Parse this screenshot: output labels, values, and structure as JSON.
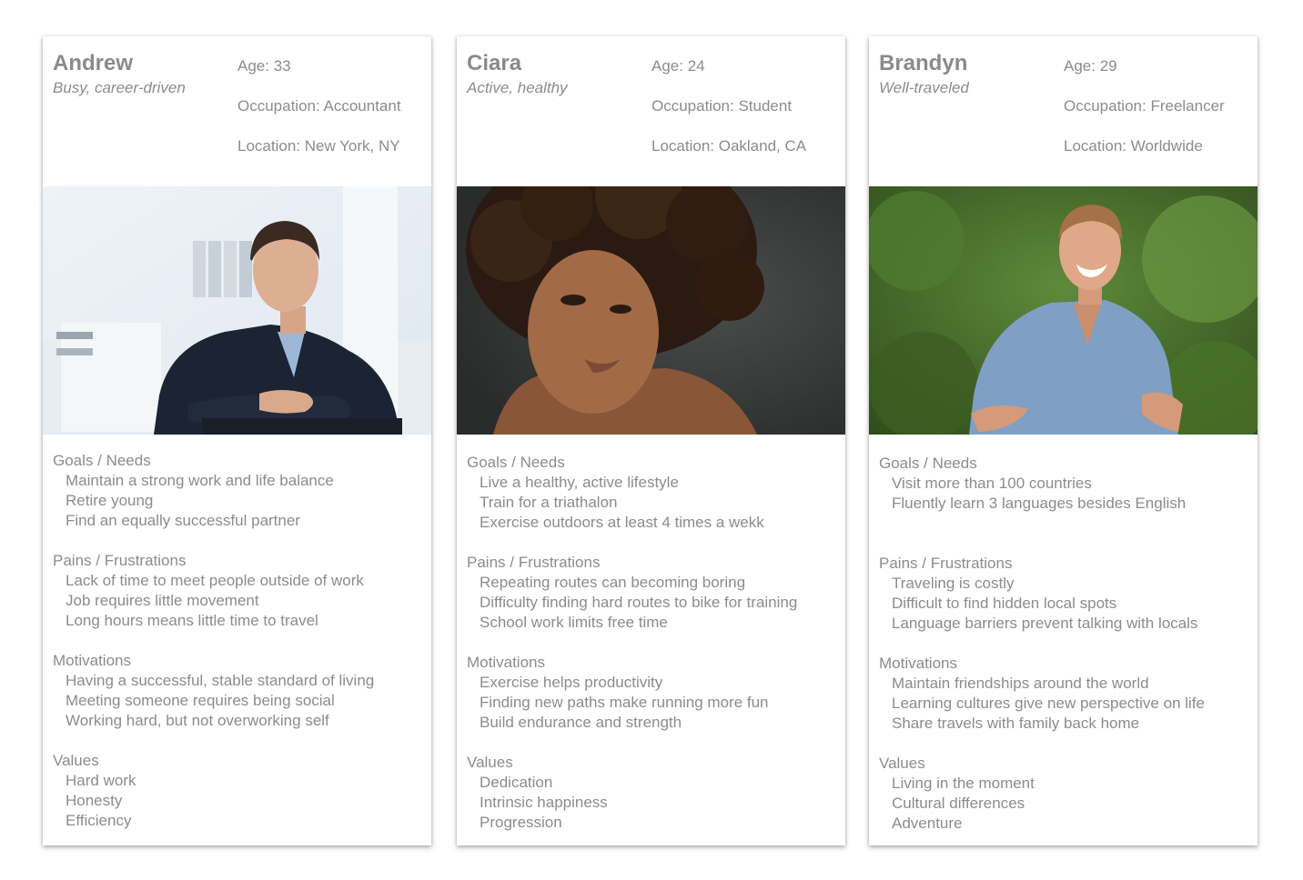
{
  "personas": [
    {
      "name": "Andrew",
      "tagline": "Busy, career-driven",
      "age": "Age: 33",
      "occupation": "Occupation: Accountant",
      "location": "Location: New York, NY",
      "goals_title": "Goals / Needs",
      "goals": [
        "Maintain a strong work and life balance",
        "Retire young",
        "Find an equally successful partner"
      ],
      "pains_title": "Pains / Frustrations",
      "pains": [
        "Lack of time to meet people outside of work",
        "Job requires little movement",
        "Long hours means little time to travel"
      ],
      "motivations_title": "Motivations",
      "motivations": [
        "Having a successful, stable standard of living",
        "Meeting someone requires being social",
        "Working hard, but not overworking self"
      ],
      "values_title": "Values",
      "values": [
        "Hard work",
        "Honesty",
        "Efficiency"
      ]
    },
    {
      "name": "Ciara",
      "tagline": "Active, healthy",
      "age": "Age: 24",
      "occupation": "Occupation: Student",
      "location": "Location: Oakland, CA",
      "goals_title": "Goals / Needs",
      "goals": [
        "Live a healthy, active lifestyle",
        "Train for a triathalon",
        "Exercise outdoors at least 4 times a wekk"
      ],
      "pains_title": "Pains / Frustrations",
      "pains": [
        "Repeating routes can becoming boring",
        "Difficulty finding hard routes to bike for training",
        "School work limits free time"
      ],
      "motivations_title": "Motivations",
      "motivations": [
        "Exercise helps productivity",
        "Finding new paths make running more fun",
        "Build endurance and strength"
      ],
      "values_title": "Values",
      "values": [
        "Dedication",
        "Intrinsic happiness",
        "Progression"
      ]
    },
    {
      "name": "Brandyn",
      "tagline": "Well-traveled",
      "age": "Age: 29",
      "occupation": "Occupation: Freelancer",
      "location": "Location: Worldwide",
      "goals_title": "Goals / Needs",
      "goals": [
        "Visit more than 100 countries",
        "Fluently learn 3 languages besides English"
      ],
      "pains_title": "Pains / Frustrations",
      "pains": [
        "Traveling is costly",
        "Difficult to find hidden local spots",
        "Language barriers prevent talking with locals"
      ],
      "motivations_title": "Motivations",
      "motivations": [
        "Maintain friendships around the world",
        "Learning cultures give new perspective on life",
        "Share travels with family back home"
      ],
      "values_title": "Values",
      "values": [
        "Living in the moment",
        "Cultural differences",
        "Adventure"
      ]
    }
  ],
  "colors": {
    "text": "#8c8c8c",
    "name": "#8a8a8a",
    "card_bg": "#ffffff"
  }
}
